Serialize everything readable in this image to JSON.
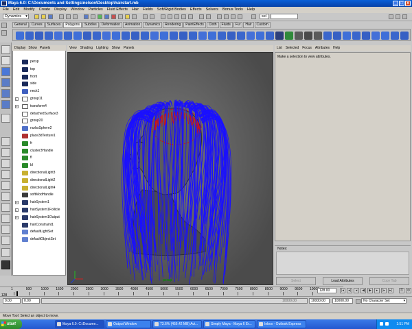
{
  "window": {
    "title": "Maya 6.0: C:\\Documents and Settings\\nelson\\Desktop\\hairstart.mb"
  },
  "menubar": [
    "File",
    "Edit",
    "Modify",
    "Create",
    "Display",
    "Window",
    "Particles",
    "Fluid Effects",
    "Hair",
    "Fields",
    "Soft/Rigid Bodies",
    "Effects",
    "Solvers",
    "Bonus Tools",
    "Help"
  ],
  "status_line": {
    "menu_set": "Dynamics",
    "selection_field": "sel"
  },
  "shelf_tabs": [
    "General",
    "Curves",
    "Surfaces",
    "Polygons",
    "Subdivs",
    "Deformation",
    "Animation",
    "Dynamics",
    "Rendering",
    "PaintEffects",
    "Cloth",
    "Fluids",
    "Fur",
    "Hair",
    "Custom"
  ],
  "shelf_active_tab": "Polygons",
  "outliner": {
    "menu": [
      "Display",
      "Show",
      "Panels"
    ],
    "items": [
      {
        "label": "persp",
        "icon": "camera-icon",
        "expand": false
      },
      {
        "label": "top",
        "icon": "camera-icon",
        "expand": false
      },
      {
        "label": "front",
        "icon": "camera-icon",
        "expand": false
      },
      {
        "label": "side",
        "icon": "camera-icon",
        "expand": false
      },
      {
        "label": "neck1",
        "icon": "mesh-icon",
        "expand": false
      },
      {
        "label": "group11",
        "icon": "group-icon",
        "expand": true
      },
      {
        "label": "transform4",
        "icon": "group-icon",
        "expand": true
      },
      {
        "label": "detachedSurface3",
        "icon": "group-icon",
        "expand": false
      },
      {
        "label": "group20",
        "icon": "group-icon",
        "expand": false
      },
      {
        "label": "nurbsSphere2",
        "icon": "nurbs-icon",
        "expand": false
      },
      {
        "label": "place3dTexture1",
        "icon": "texture-icon",
        "expand": false
      },
      {
        "label": "fr",
        "icon": "locator-icon",
        "expand": false
      },
      {
        "label": "cluster3Handle",
        "icon": "cluster-icon",
        "expand": false
      },
      {
        "label": "fl",
        "icon": "locator-icon",
        "expand": false
      },
      {
        "label": "bl",
        "icon": "locator-icon",
        "expand": false
      },
      {
        "label": "directionalLight3",
        "icon": "light-icon",
        "expand": false
      },
      {
        "label": "directionalLight2",
        "icon": "light-icon",
        "expand": false
      },
      {
        "label": "directionalLight4",
        "icon": "light-icon",
        "expand": false
      },
      {
        "label": "softModHandle",
        "icon": "softmod-icon",
        "expand": false
      },
      {
        "label": "hairSystem1",
        "icon": "hair-icon",
        "expand": true
      },
      {
        "label": "hairSystem1Follicle",
        "icon": "hair-icon",
        "expand": true
      },
      {
        "label": "hairSystem1Output",
        "icon": "hair-icon",
        "expand": true
      },
      {
        "label": "hairConstraint1",
        "icon": "hair-icon",
        "expand": false
      },
      {
        "label": "defaultLightSet",
        "icon": "set-icon",
        "expand": false
      },
      {
        "label": "defaultObjectSet",
        "icon": "set-icon",
        "expand": false
      }
    ]
  },
  "viewport": {
    "menu": [
      "View",
      "Shading",
      "Lighting",
      "Show",
      "Panels"
    ],
    "camera_label": "persp"
  },
  "attribute_editor": {
    "menu": [
      "List",
      "Selected",
      "Focus",
      "Attributes",
      "Help"
    ],
    "message": "Make a selection to view attributes.",
    "notes_label": "Notes:",
    "buttons": [
      "Select",
      "Load Attributes",
      "Copy Tab"
    ]
  },
  "timeline": {
    "ticks": [
      "1",
      "500",
      "1000",
      "1500",
      "2000",
      "2500",
      "3000",
      "3500",
      "4000",
      "4500",
      "5000",
      "5500",
      "6000",
      "6500",
      "7000",
      "7500",
      "8000",
      "8500",
      "9000",
      "9500",
      "10000"
    ],
    "current_frame": "128.00",
    "cursor_value": "128"
  },
  "range": {
    "start": "0.00",
    "playback_start": "0.00",
    "playback_end": "10000.00",
    "end": "10000.00",
    "slider_end_label": "10000.00",
    "character_set": "No Character Set"
  },
  "help_line": "Move Tool: Select an object to move.",
  "taskbar": {
    "start": "start",
    "items": [
      {
        "label": "Maya 6.0: C:\\Docume...",
        "active": true
      },
      {
        "label": "Output Window",
        "active": false
      },
      {
        "label": "73.6% (456.42 MB) Avi...",
        "active": false
      },
      {
        "label": "Simply Maya - Maya 6 Er...",
        "active": false
      },
      {
        "label": "Inbox - Outlook Express",
        "active": false
      }
    ],
    "clock": "1:51 PM"
  },
  "colors": {
    "hair": "#1a10ff",
    "hair_curve": "#d01010",
    "viewport_bg": "#5a5a5a",
    "titlebar": "#0a5fd8"
  }
}
